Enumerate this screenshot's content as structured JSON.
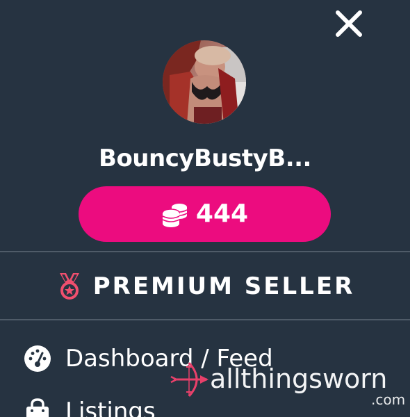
{
  "theme": {
    "drawer_bg": "#263341",
    "accent": "#ec0c7f",
    "medal_color": "#f04f6e",
    "divider": "#4f5b68"
  },
  "drawer": {
    "close_icon": "close-icon",
    "profile": {
      "username": "BouncyBustyB..."
    },
    "balance": {
      "icon": "coins-icon",
      "value": "444"
    },
    "badge": {
      "icon": "medal-icon",
      "label": "PREMIUM SELLER"
    },
    "menu": [
      {
        "icon": "dashboard-gauge-icon",
        "label": "Dashboard / Feed"
      },
      {
        "icon": "shopping-bag-icon",
        "label": "Listings"
      }
    ]
  },
  "backdrop": {
    "partial_text": "e"
  },
  "watermark": {
    "name": "allthingsworn",
    "tld": ".com"
  }
}
